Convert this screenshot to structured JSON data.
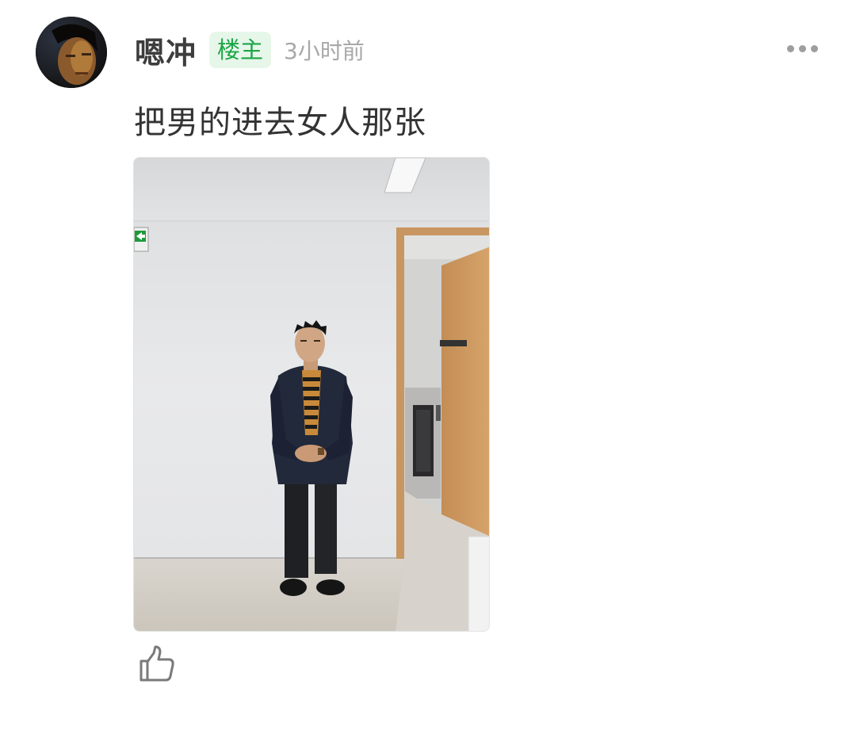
{
  "post": {
    "author": {
      "name": "嗯冲",
      "badge": "楼主",
      "avatar_icon": "user-avatar-photo"
    },
    "time": "3小时前",
    "content": "把男的进去女人那张",
    "image": {
      "description_icon": "photo-man-standing-in-office"
    },
    "actions": {
      "more_icon": "more-dots-icon",
      "like_icon": "thumbs-up-icon"
    }
  },
  "colors": {
    "badge_text": "#1ea546",
    "badge_bg": "#e6f7ea",
    "muted": "#a8a8a8",
    "text": "#333333"
  }
}
